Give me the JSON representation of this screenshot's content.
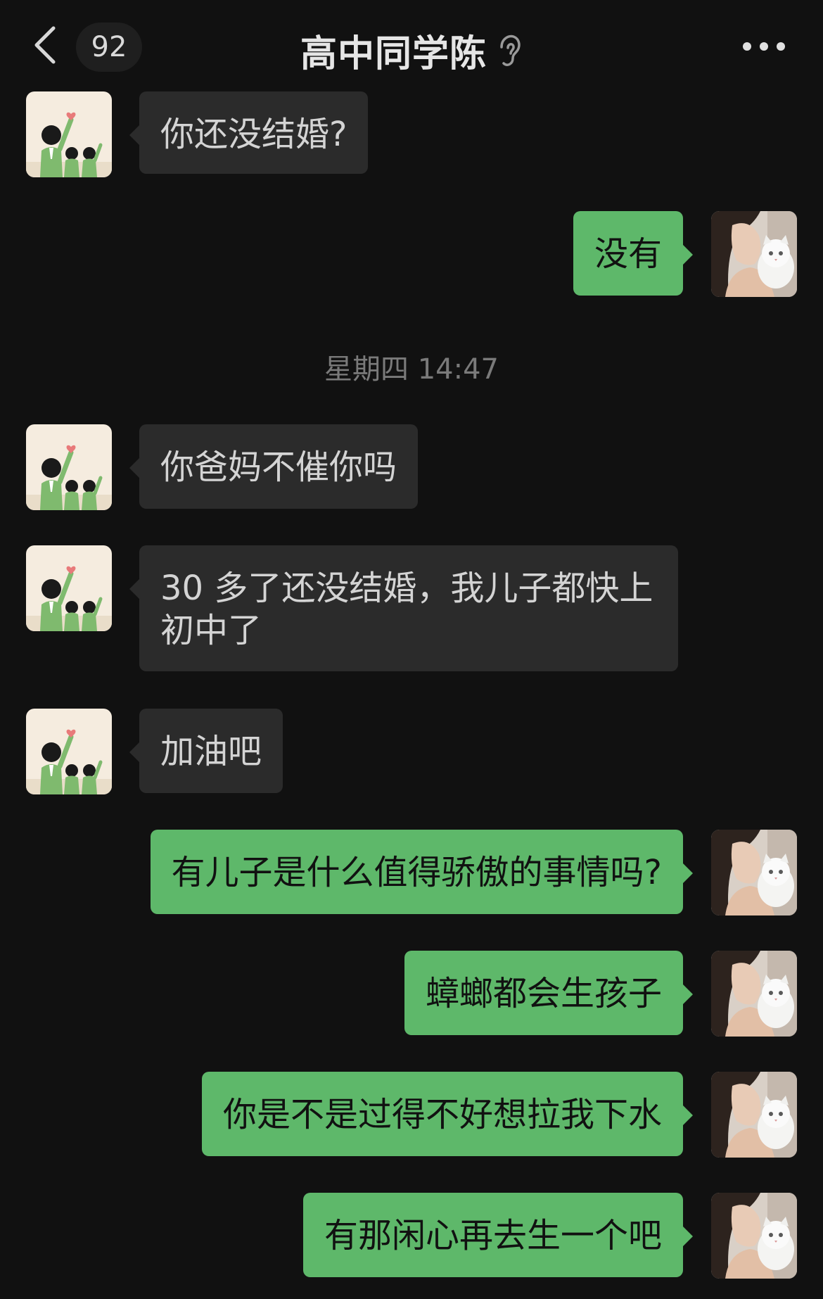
{
  "header": {
    "unread_count": "92",
    "title": "高中同学陈",
    "back_icon": "chevron-left-icon",
    "mode_icon": "ear-icon",
    "more_icon": "more-dots-icon"
  },
  "colors": {
    "background": "#111111",
    "incoming_bubble": "#2b2b2b",
    "outgoing_bubble": "#5eb86a"
  },
  "messages": [
    {
      "sender": "contact",
      "text": "你还没结婚?"
    },
    {
      "sender": "me",
      "text": "没有"
    },
    {
      "sender": "contact",
      "text": "你爸妈不催你吗"
    },
    {
      "sender": "contact",
      "text": "30 多了还没结婚，我儿子都快上初中了"
    },
    {
      "sender": "contact",
      "text": "加油吧"
    },
    {
      "sender": "me",
      "text": "有儿子是什么值得骄傲的事情吗?"
    },
    {
      "sender": "me",
      "text": "蟑螂都会生孩子"
    },
    {
      "sender": "me",
      "text": "你是不是过得不好想拉我下水"
    },
    {
      "sender": "me",
      "text": "有那闲心再去生一个吧"
    }
  ],
  "timestamp": "星期四 14:47"
}
